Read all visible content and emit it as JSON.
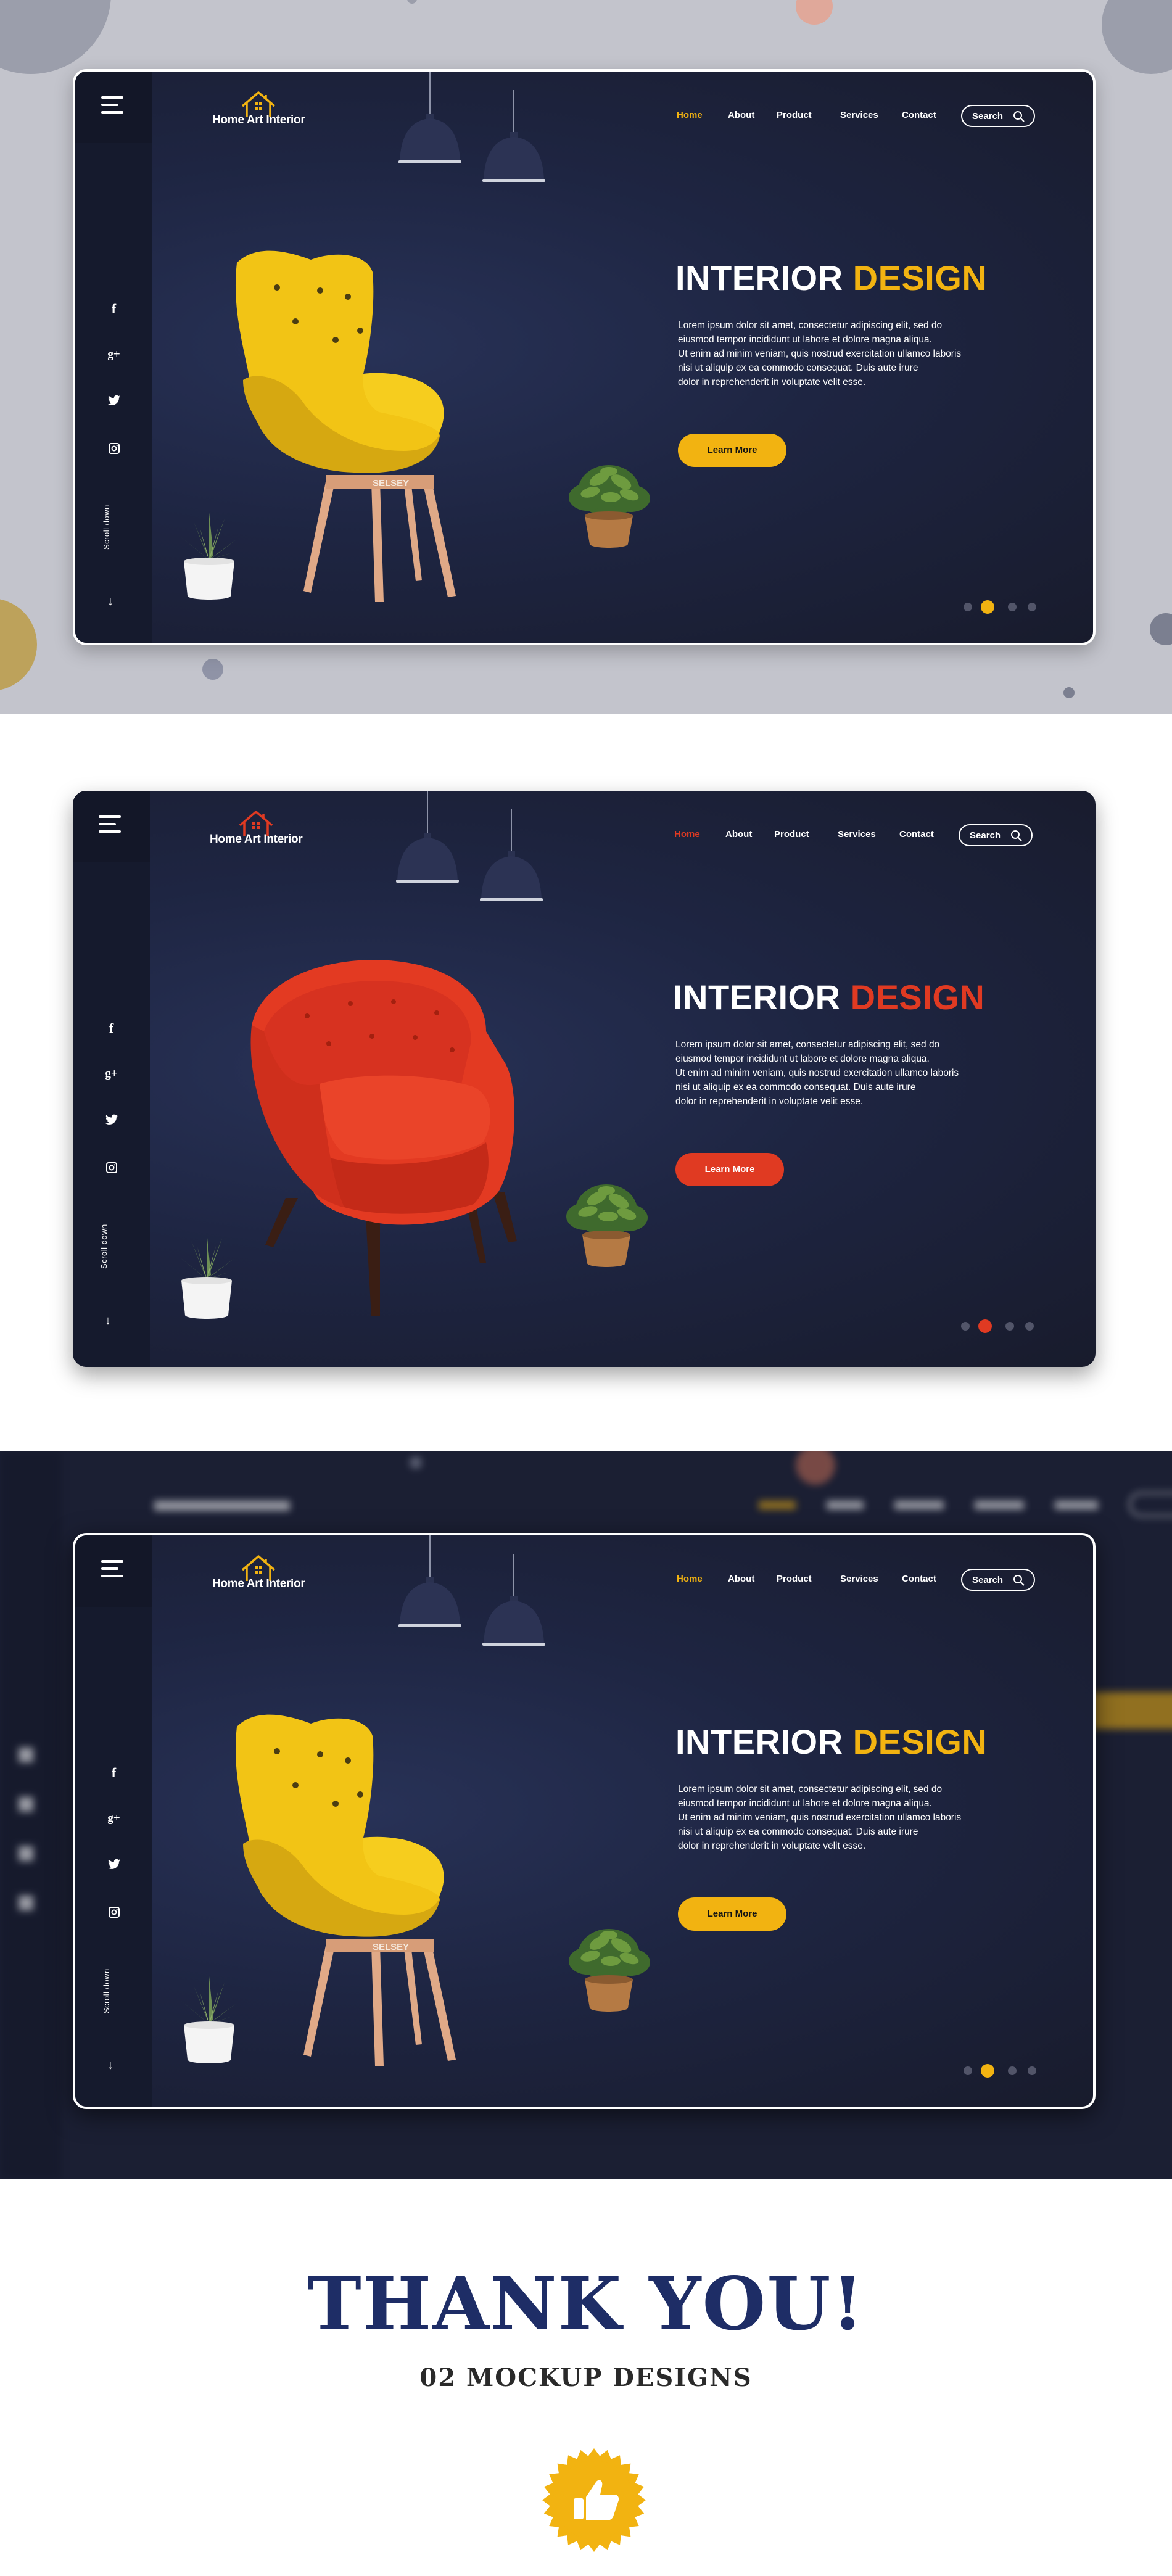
{
  "brand": {
    "logo_text": "Home Art Interior"
  },
  "nav": {
    "items": [
      "Home",
      "About",
      "Product",
      "Services",
      "Contact"
    ],
    "search_label": "Search"
  },
  "social_icons": [
    "facebook-icon",
    "google-plus-icon",
    "twitter-icon",
    "instagram-icon"
  ],
  "social_glyphs": [
    "f",
    "g+",
    "t",
    "◘"
  ],
  "scroll_label": "Scroll down",
  "hero": {
    "title_white": "INTERIOR",
    "title_accent": "DESIGN",
    "body_lines": [
      "Lorem ipsum dolor sit amet, consectetur adipiscing elit, sed do",
      "eiusmod tempor incididunt ut labore et dolore magna aliqua.",
      "Ut enim ad minim veniam, quis nostrud exercitation ullamco laboris",
      "nisi ut aliquip ex ea commodo consequat. Duis aute irure",
      "dolor in reprehenderit in voluptate velit esse."
    ],
    "cta_label": "Learn More",
    "chair_brand": "SELSEY"
  },
  "mockups": [
    {
      "variant": "yellow",
      "accent": "#f2b311",
      "active_dot": 1,
      "dot_count": 4
    },
    {
      "variant": "red",
      "accent": "#e03a22",
      "active_dot": 1,
      "dot_count": 4
    },
    {
      "variant": "yellow",
      "accent": "#f2b311",
      "active_dot": 1,
      "dot_count": 4
    }
  ],
  "closing": {
    "title": "THANK YOU!",
    "subtitle": "02 MOCKUP DESIGNS",
    "badge_icon": "thumbs-up-icon",
    "badge_color": "#f2b311",
    "title_color": "#1e2d66"
  }
}
